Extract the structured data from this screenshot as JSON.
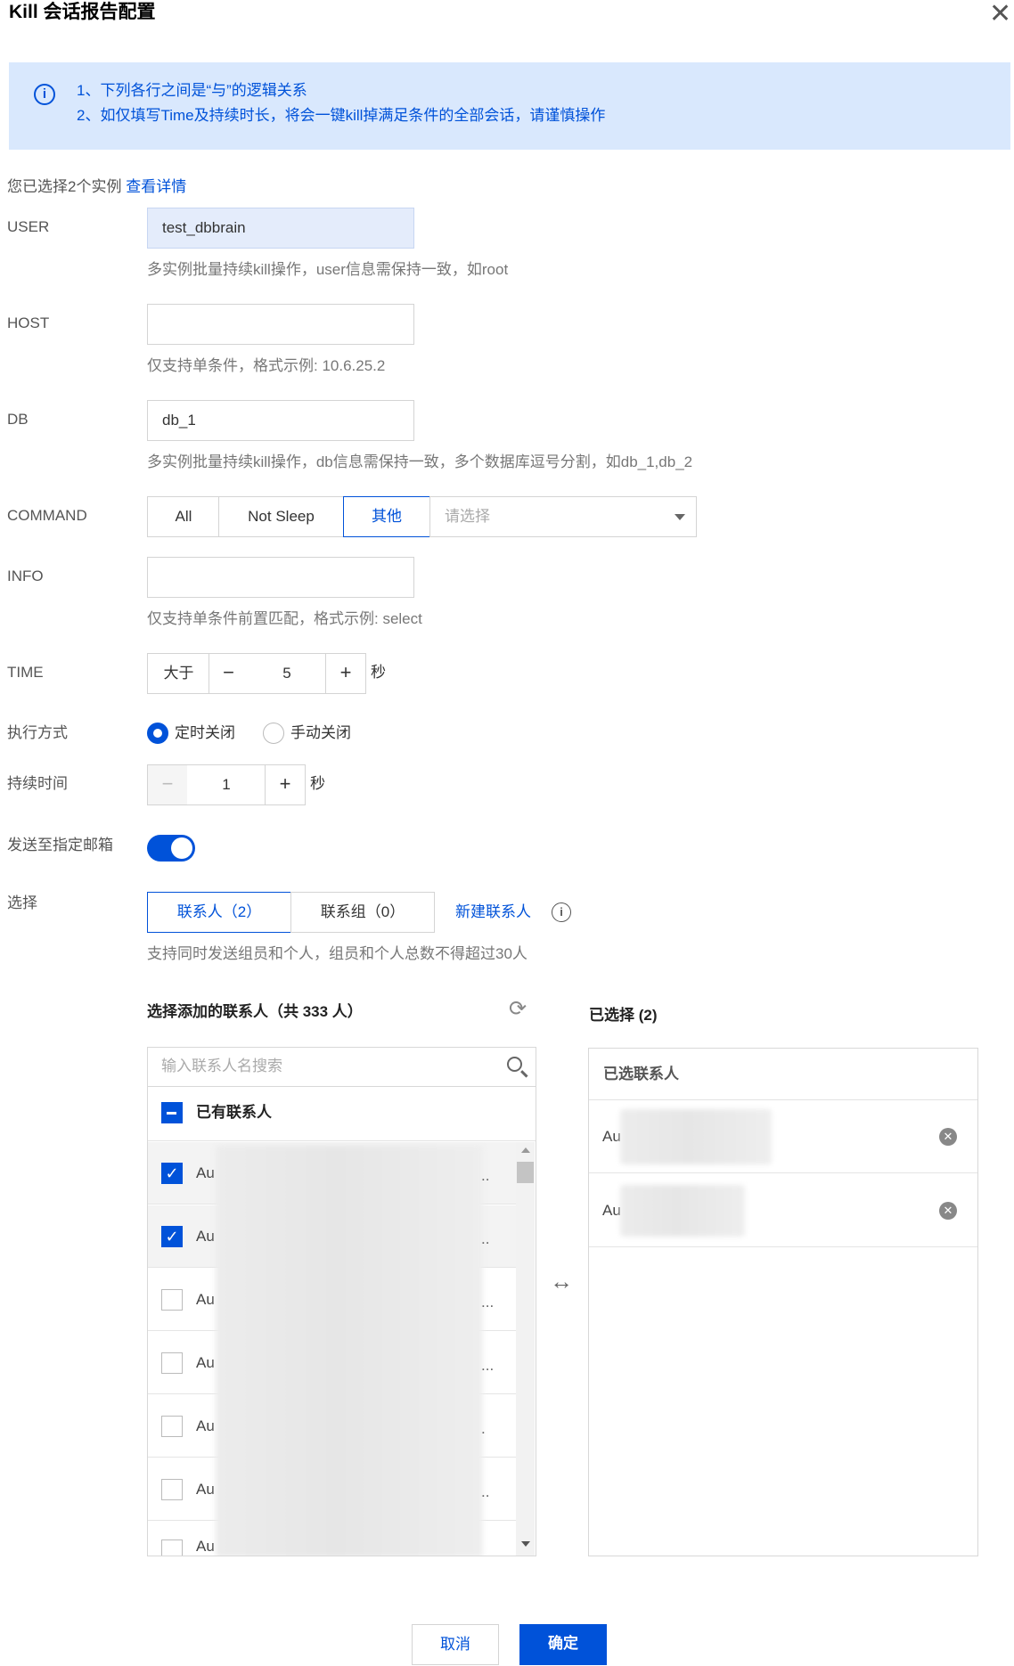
{
  "dialog": {
    "title": "Kill 会话报告配置"
  },
  "notice": {
    "line1": "1、下列各行之间是“与”的逻辑关系",
    "line2": "2、如仅填写Time及持续时长，将会一键kill掉满足条件的全部会话，请谨慎操作"
  },
  "selection": {
    "text": "您已选择2个实例",
    "link": "查看详情"
  },
  "user": {
    "label": "USER",
    "value": "test_dbbrain",
    "hint": "多实例批量持续kill操作，user信息需保持一致，如root"
  },
  "host": {
    "label": "HOST",
    "value": "",
    "hint": "仅支持单条件，格式示例: 10.6.25.2"
  },
  "db": {
    "label": "DB",
    "value": "db_1",
    "hint": "多实例批量持续kill操作，db信息需保持一致，多个数据库逗号分割，如db_1,db_2"
  },
  "command": {
    "label": "COMMAND",
    "options": [
      "All",
      "Not Sleep",
      "其他"
    ],
    "active": "其他",
    "select_placeholder": "请选择"
  },
  "info": {
    "label": "INFO",
    "value": "",
    "hint": "仅支持单条件前置匹配，格式示例: select"
  },
  "time": {
    "label": "TIME",
    "operator": "大于",
    "value": "5",
    "unit": "秒"
  },
  "exec": {
    "label": "执行方式",
    "options": [
      "定时关闭",
      "手动关闭"
    ],
    "selected": "定时关闭"
  },
  "duration": {
    "label": "持续时间",
    "value": "1",
    "unit": "秒"
  },
  "email": {
    "label": "发送至指定邮箱",
    "enabled": true
  },
  "choose": {
    "label": "选择",
    "tabs": [
      "联系人（2）",
      "联系组（0）"
    ],
    "active_tab": "联系人（2）",
    "new_contact": "新建联系人",
    "hint": "支持同时发送组员和个人，组员和个人总数不得超过30人"
  },
  "transfer": {
    "left_title": "选择添加的联系人（共 333 人）",
    "search_placeholder": "输入联系人名搜索",
    "group_label": "已有联系人",
    "rows": [
      {
        "text": "Au",
        "checked": true
      },
      {
        "text": "Au",
        "checked": true
      },
      {
        "text": "Au",
        "checked": false
      },
      {
        "text": "Au",
        "checked": false
      },
      {
        "text": "Au",
        "checked": false
      },
      {
        "text": "Au",
        "checked": false
      },
      {
        "text": "Au",
        "checked": false
      }
    ],
    "right_title": "已选择 (2)",
    "right_header": "已选联系人",
    "selected_rows": [
      "Au",
      "Au"
    ]
  },
  "footer": {
    "cancel": "取消",
    "confirm": "确定"
  },
  "colors": {
    "primary": "#0052d9",
    "notice_bg": "#d9e8fd"
  }
}
